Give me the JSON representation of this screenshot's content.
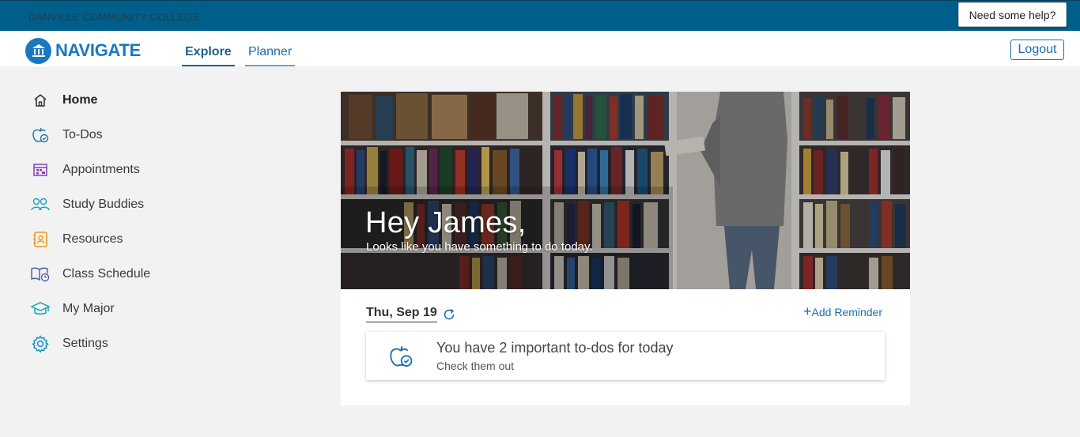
{
  "topbar": {
    "college_name": "DANVILLE COMMUNITY COLLEGE",
    "help_label": "Need some help?",
    "bg_color": "#005e8a"
  },
  "header": {
    "logo_text": "NAVIGATE",
    "tabs": [
      {
        "label": "Explore",
        "active": true
      },
      {
        "label": "Planner",
        "active": false
      }
    ],
    "logout_label": "Logout"
  },
  "sidebar": {
    "items": [
      {
        "label": "Home",
        "icon": "home-icon",
        "active": true
      },
      {
        "label": "To-Dos",
        "icon": "apple-check-icon"
      },
      {
        "label": "Appointments",
        "icon": "calendar-icon"
      },
      {
        "label": "Study Buddies",
        "icon": "people-icon"
      },
      {
        "label": "Resources",
        "icon": "contact-book-icon"
      },
      {
        "label": "Class Schedule",
        "icon": "book-clock-icon"
      },
      {
        "label": "My Major",
        "icon": "graduation-cap-icon"
      },
      {
        "label": "Settings",
        "icon": "gear-icon"
      }
    ]
  },
  "hero": {
    "greeting": "Hey James,",
    "subtitle": "Looks like you have something to do today."
  },
  "main": {
    "date": "Thu, Sep 19",
    "add_reminder": "Add Reminder",
    "card": {
      "title": "You have 2 important to-dos for today",
      "subtitle": "Check them out"
    }
  }
}
